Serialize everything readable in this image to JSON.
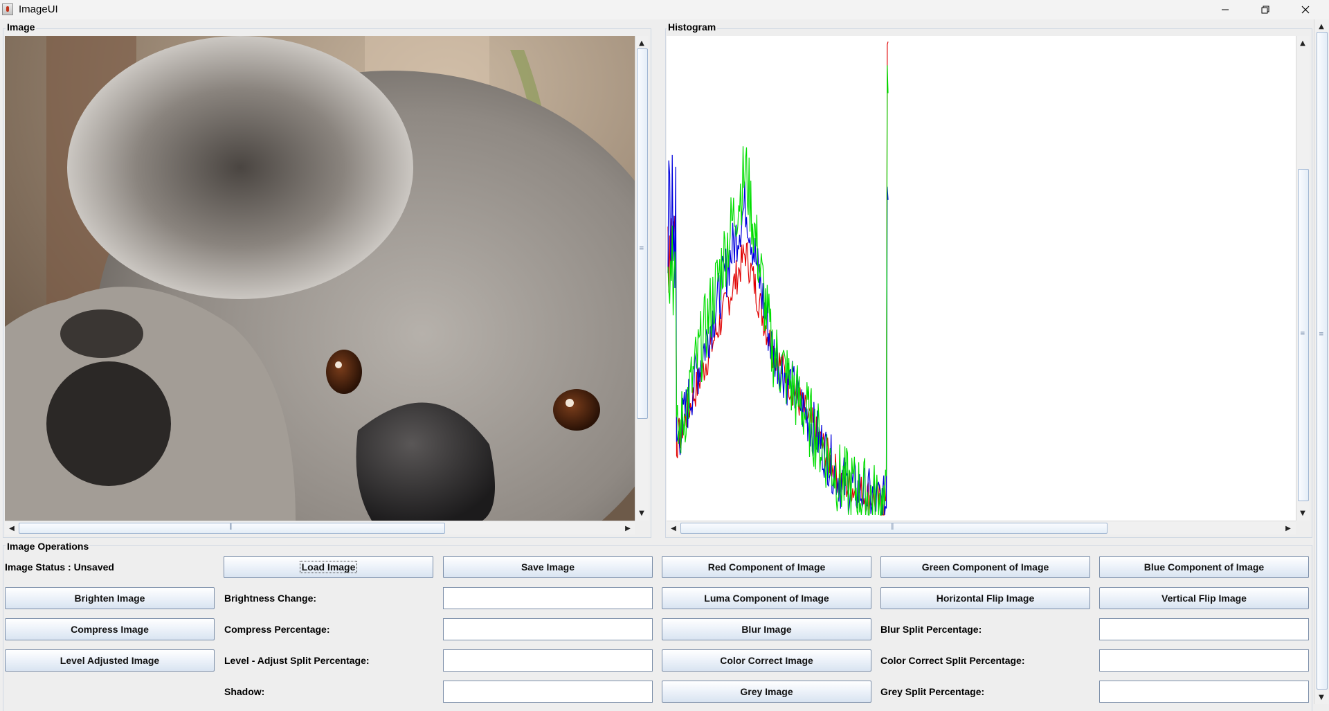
{
  "window": {
    "title": "ImageUI",
    "controls": [
      "minimize-icon",
      "restore-icon",
      "close-icon"
    ]
  },
  "image_panel": {
    "label": "Image"
  },
  "histogram_panel": {
    "label": "Histogram",
    "colors": {
      "red": "#e00000",
      "green": "#00dd00",
      "blue": "#0000dd"
    },
    "x_range": [
      0,
      255
    ],
    "y_range": [
      0,
      1
    ]
  },
  "operations": {
    "label": "Image Operations",
    "status": "Image Status : Unsaved",
    "buttons": {
      "load": "Load Image",
      "save": "Save Image",
      "red": "Red Component of Image",
      "green": "Green Component of Image",
      "blue": "Blue Component of Image",
      "brighten": "Brighten Image",
      "luma": "Luma Component of Image",
      "hflip": "Horizontal Flip Image",
      "vflip": "Vertical Flip Image",
      "compress": "Compress Image",
      "blur": "Blur Image",
      "level": "Level Adjusted Image",
      "color_correct": "Color Correct Image",
      "grey": "Grey Image"
    },
    "labels": {
      "brightness": "Brightness Change:",
      "compress_pct": "Compress Percentage:",
      "blur_split": "Blur Split Percentage:",
      "level_split": "Level - Adjust Split Percentage:",
      "color_correct_split": "Color Correct Split Percentage:",
      "shadow": "Shadow:",
      "grey_split": "Grey Split Percentage:"
    },
    "fields": {
      "brightness": "",
      "compress_pct": "",
      "blur_split": "",
      "level_split": "",
      "color_correct_split": "",
      "shadow": "",
      "grey_split": ""
    }
  }
}
